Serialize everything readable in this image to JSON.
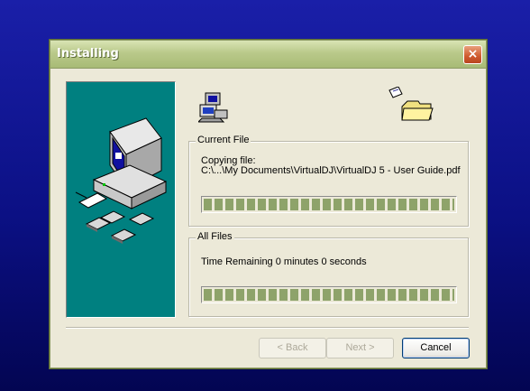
{
  "window": {
    "title": "Installing",
    "close_label": "×"
  },
  "side_panel": {
    "illustration": "computer-with-floppy-disks"
  },
  "icons": {
    "top_left": "computers-icon",
    "top_right": "file-to-folder-icon"
  },
  "current_file": {
    "legend": "Current File",
    "copying_label": "Copying file:",
    "path": "C:\\...\\My Documents\\VirtualDJ\\VirtualDJ 5 - User Guide.pdf",
    "progress": 1.0
  },
  "all_files": {
    "legend": "All Files",
    "time_remaining": "Time Remaining 0 minutes 0 seconds",
    "progress": 1.0
  },
  "buttons": {
    "back": "< Back",
    "next": "Next >",
    "cancel": "Cancel"
  },
  "colors": {
    "panel": "#008080",
    "progress_fill": "#8ea36a",
    "title_bar": "#b9c98a"
  }
}
